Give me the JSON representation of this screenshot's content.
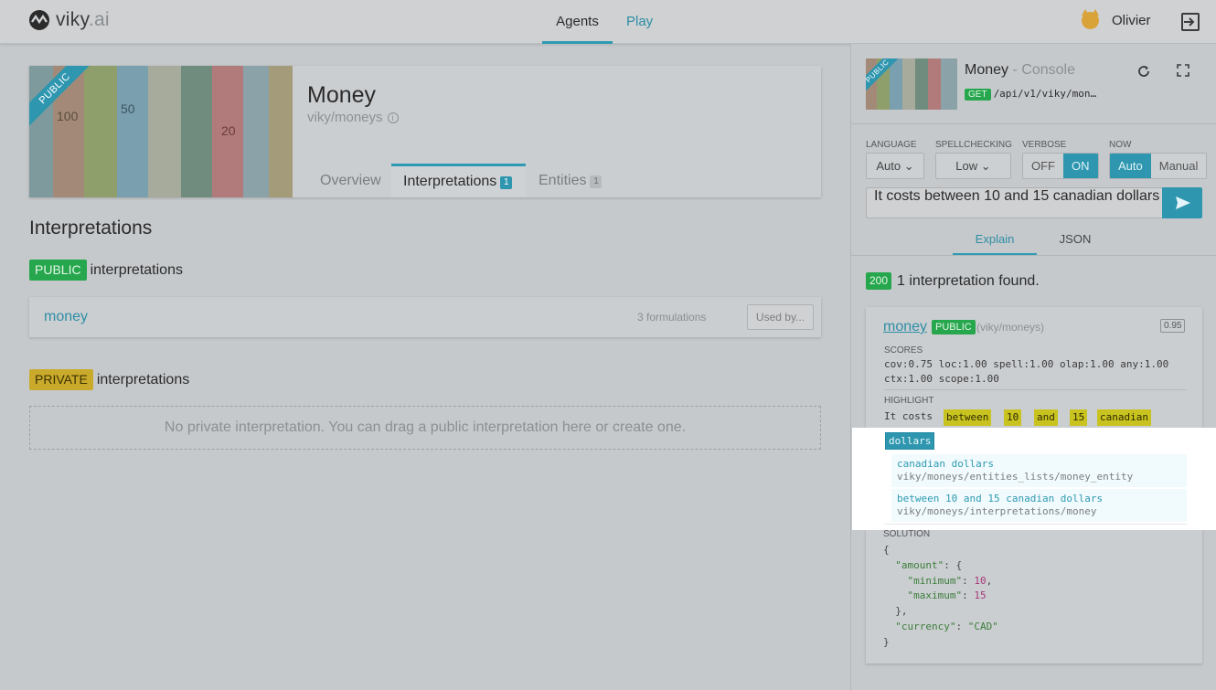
{
  "nav": {
    "brand": "viky",
    "brand_suffix": ".ai",
    "tabs": [
      {
        "label": "Agents",
        "active": true
      },
      {
        "label": "Play",
        "active": false
      }
    ],
    "user": "Olivier"
  },
  "agent": {
    "title": "Money",
    "slug": "viky/moneys",
    "ribbon": "PUBLIC",
    "tabs": [
      {
        "label": "Overview"
      },
      {
        "label": "Interpretations",
        "count": "1"
      },
      {
        "label": "Entities",
        "count": "1"
      }
    ]
  },
  "interpretations": {
    "title": "Interpretations",
    "public_badge": "PUBLIC",
    "public_label": "interpretations",
    "items": [
      {
        "name": "money",
        "formulations": "3 formulations",
        "used_by": "Used by..."
      }
    ],
    "private_badge": "PRIVATE",
    "private_label": "interpretations",
    "private_empty": "No private interpretation. You can drag a public interpretation here or create one."
  },
  "console": {
    "title": "Money",
    "title_suffix": "- Console",
    "method": "GET",
    "url": "/api/v1/viky/mon…",
    "controls": {
      "language_label": "LANGUAGE",
      "language_value": "Auto",
      "spell_label": "SPELLCHECKING",
      "spell_value": "Low",
      "verbose_label": "VERBOSE",
      "verbose_off": "OFF",
      "verbose_on": "ON",
      "now_label": "NOW",
      "now_auto": "Auto",
      "now_manual": "Manual"
    },
    "query": "It costs between 10 and 15 canadian dollars",
    "tabs": [
      "Explain",
      "JSON"
    ],
    "status_code": "200",
    "status_text": "1 interpretation found.",
    "result": {
      "name": "money",
      "badge": "PUBLIC",
      "slug": "(viky/moneys)",
      "score": "0.95",
      "scores_label": "SCORES",
      "scores_line1": "cov:0.75 loc:1.00 spell:1.00 olap:1.00 any:1.00",
      "scores_line2": "ctx:1.00 scope:1.00",
      "highlight_label": "HIGHLIGHT",
      "highlight_prefix": "It costs",
      "highlight_words": [
        "between",
        "10",
        "and",
        "15",
        "canadian"
      ],
      "highlight_selected": "dollars",
      "matches": [
        {
          "text": "canadian dollars",
          "path": "viky/moneys/entities_lists/money_entity"
        },
        {
          "text": "between 10 and 15 canadian dollars",
          "path": "viky/moneys/interpretations/money"
        }
      ],
      "solution_label": "SOLUTION",
      "solution": {
        "amount_key": "\"amount\"",
        "minimum_key": "\"minimum\"",
        "minimum_val": "10",
        "maximum_key": "\"maximum\"",
        "maximum_val": "15",
        "currency_key": "\"currency\"",
        "currency_val": "\"CAD\""
      }
    }
  },
  "colors": {
    "accent": "#2f96af",
    "public": "#27a74d",
    "private": "#c9aa2b",
    "highlight": "#c9c320"
  }
}
